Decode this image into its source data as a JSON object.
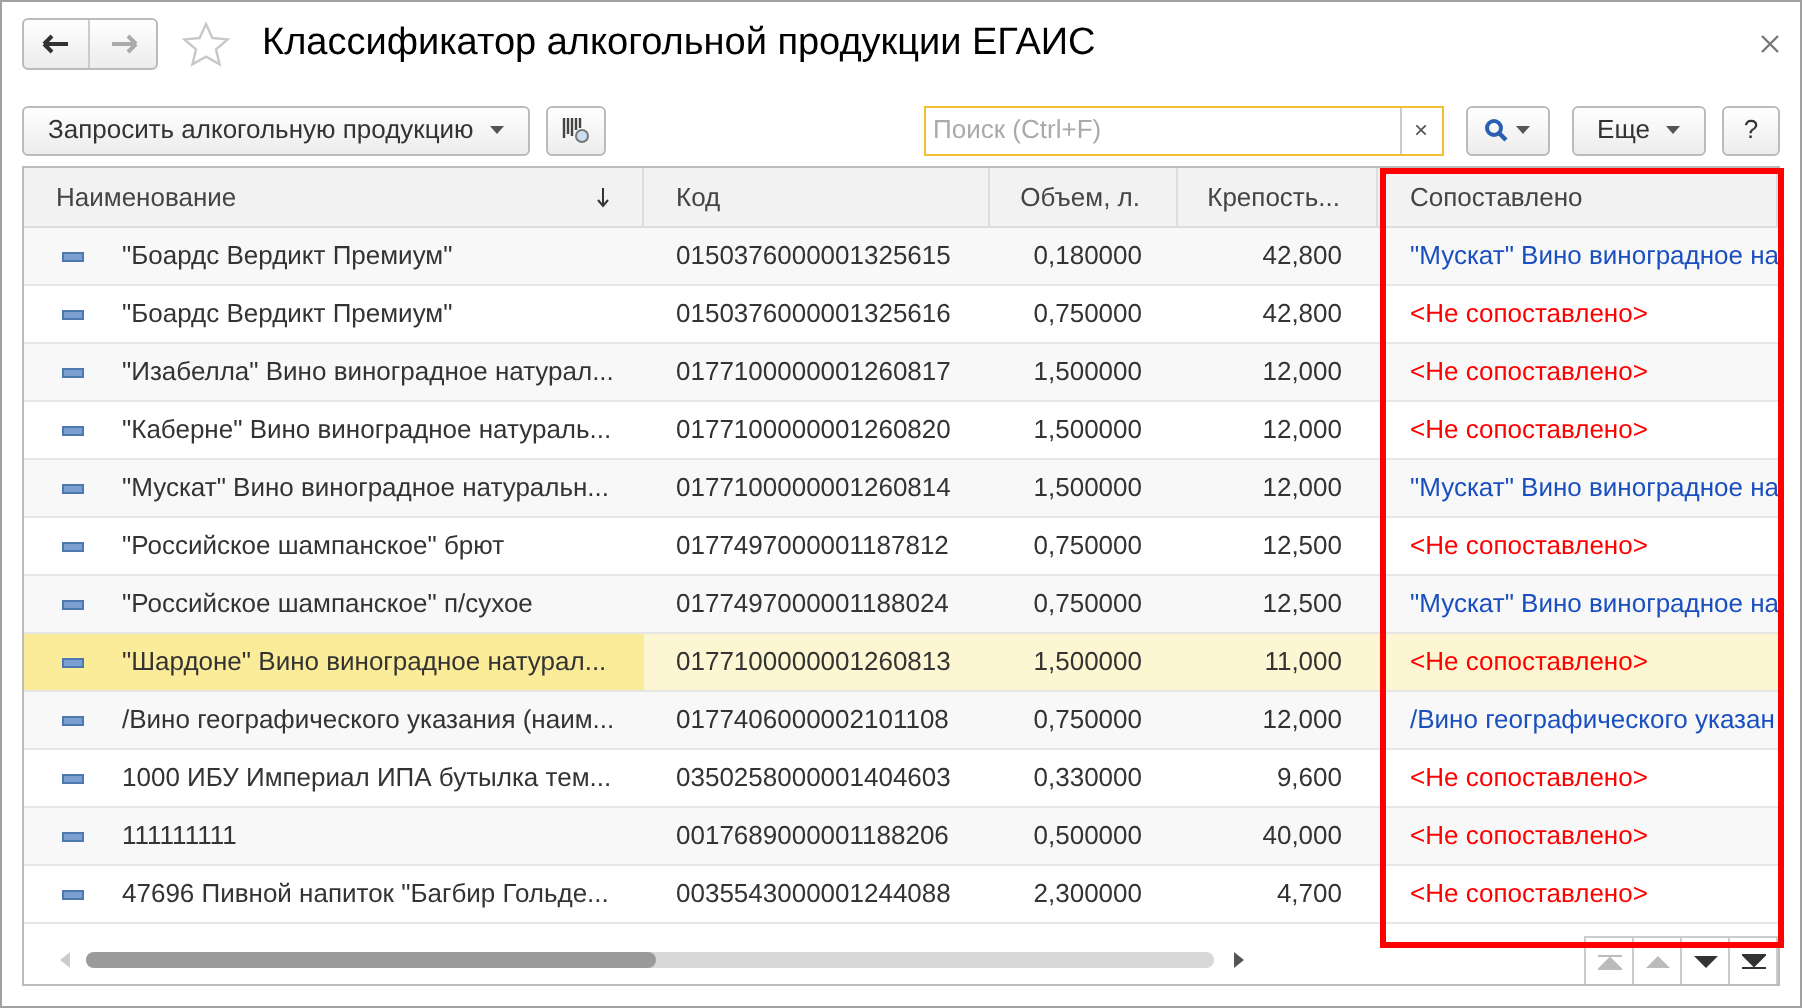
{
  "window": {
    "title": "Классификатор алкогольной продукции ЕГАИС"
  },
  "toolbar": {
    "request_button": "Запросить алкогольную продукцию",
    "search": {
      "placeholder": "Поиск (Ctrl+F)"
    },
    "clear": "×",
    "more_button": "Еще",
    "help_button": "?"
  },
  "table": {
    "columns": [
      {
        "label": "Наименование",
        "sorted": true
      },
      {
        "label": "Код",
        "sorted": false
      },
      {
        "label": "Объем, л.",
        "sorted": false
      },
      {
        "label": "Крепость...",
        "sorted": false
      },
      {
        "label": "Сопоставлено",
        "sorted": false
      }
    ],
    "rows": [
      {
        "name": "\"Боардс Вердикт Премиум\"",
        "code": "0150376000001325615",
        "volume": "0,180000",
        "strength": "42,800",
        "matched": "\"Мускат\" Вино виноградное на",
        "kind": "matched",
        "selected": false
      },
      {
        "name": "\"Боардс Вердикт Премиум\"",
        "code": "0150376000001325616",
        "volume": "0,750000",
        "strength": "42,800",
        "matched": "<Не сопоставлено>",
        "kind": "unmatched",
        "selected": false
      },
      {
        "name": "\"Изабелла\" Вино виноградное натурал...",
        "code": "0177100000001260817",
        "volume": "1,500000",
        "strength": "12,000",
        "matched": "<Не сопоставлено>",
        "kind": "unmatched",
        "selected": false
      },
      {
        "name": "\"Каберне\" Вино виноградное натураль...",
        "code": "0177100000001260820",
        "volume": "1,500000",
        "strength": "12,000",
        "matched": "<Не сопоставлено>",
        "kind": "unmatched",
        "selected": false
      },
      {
        "name": "\"Мускат\" Вино виноградное натуральн...",
        "code": "0177100000001260814",
        "volume": "1,500000",
        "strength": "12,000",
        "matched": "\"Мускат\" Вино виноградное на",
        "kind": "matched",
        "selected": false
      },
      {
        "name": "\"Российское шампанское\" брют",
        "code": "0177497000001187812",
        "volume": "0,750000",
        "strength": "12,500",
        "matched": "<Не сопоставлено>",
        "kind": "unmatched",
        "selected": false
      },
      {
        "name": "\"Российское шампанское\" п/сухое",
        "code": "0177497000001188024",
        "volume": "0,750000",
        "strength": "12,500",
        "matched": "\"Мускат\" Вино виноградное на",
        "kind": "matched",
        "selected": false
      },
      {
        "name": "\"Шардоне\" Вино виноградное натурал...",
        "code": "0177100000001260813",
        "volume": "1,500000",
        "strength": "11,000",
        "matched": "<Не сопоставлено>",
        "kind": "unmatched",
        "selected": true
      },
      {
        "name": "/Вино географического указания (наим...",
        "code": "0177406000002101108",
        "volume": "0,750000",
        "strength": "12,000",
        "matched": "/Вино географического указан",
        "kind": "matched",
        "selected": false
      },
      {
        "name": "1000 ИБУ Империал ИПА бутылка тем...",
        "code": "0350258000001404603",
        "volume": "0,330000",
        "strength": "9,600",
        "matched": "<Не сопоставлено>",
        "kind": "unmatched",
        "selected": false
      },
      {
        "name": "111111111",
        "code": "0017689000001188206",
        "volume": "0,500000",
        "strength": "40,000",
        "matched": "<Не сопоставлено>",
        "kind": "unmatched",
        "selected": false
      },
      {
        "name": "47696 Пивной напиток \"Багбир Гольде...",
        "code": "0035543000001244088",
        "volume": "2,300000",
        "strength": "4,700",
        "matched": "<Не сопоставлено>",
        "kind": "unmatched",
        "selected": false
      }
    ]
  }
}
